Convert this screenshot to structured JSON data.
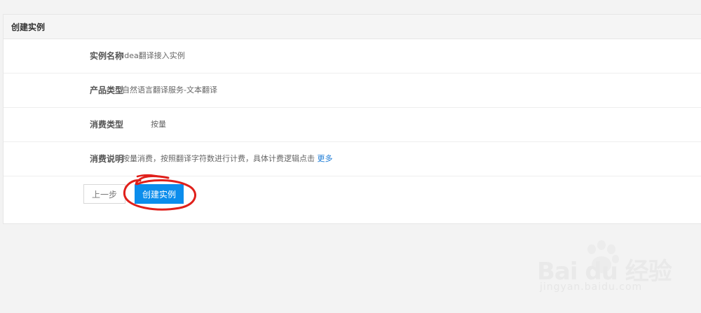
{
  "panel": {
    "title": "创建实例"
  },
  "rows": [
    {
      "label": "实例名称",
      "value": "Idea翻译接入实例"
    },
    {
      "label": "产品类型",
      "value": "自然语言翻译服务-文本翻译"
    },
    {
      "label": "消费类型",
      "value": "按量"
    },
    {
      "label": "消费说明",
      "value": "按量消费，按照翻译字符数进行计费，具体计费逻辑点击",
      "link": "更多"
    }
  ],
  "buttons": {
    "prev": "上一步",
    "create": "创建实例"
  },
  "watermark": {
    "brand": "Bai du 经验",
    "url": "jingyan.baidu.com"
  },
  "colors": {
    "primary": "#0b8dec",
    "link": "#1b7bd6",
    "annotation": "#e0201b"
  }
}
